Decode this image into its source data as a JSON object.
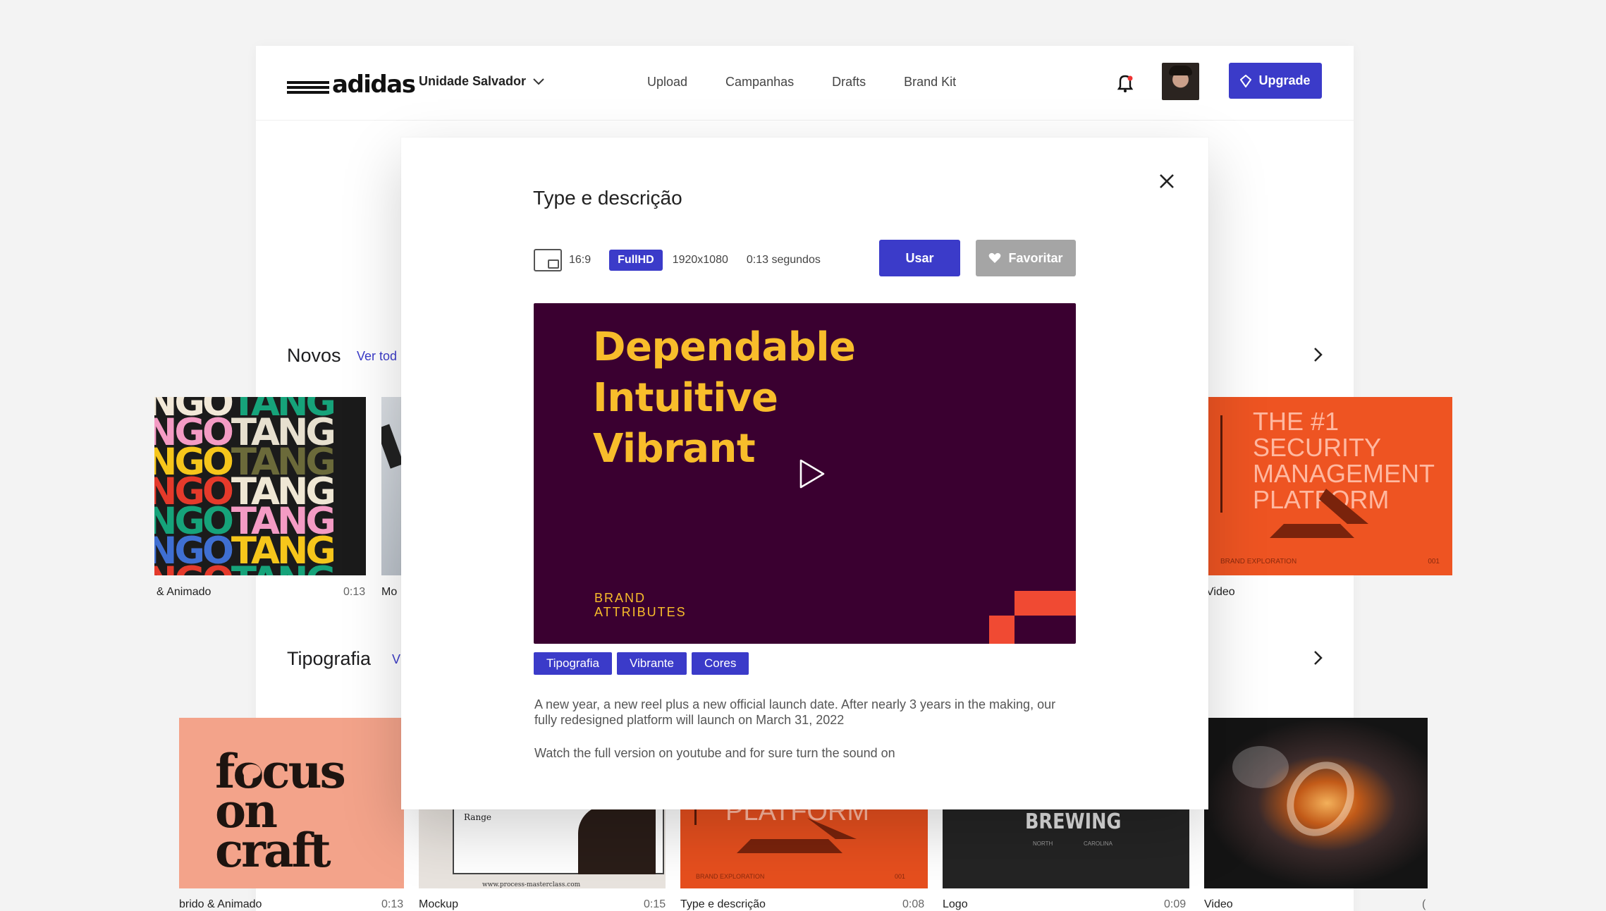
{
  "header": {
    "logo_text": "adidas",
    "unit_label": "Unidade Salvador",
    "nav": [
      "Upload",
      "Campanhas",
      "Drafts",
      "Brand Kit"
    ],
    "upgrade_label": "Upgrade"
  },
  "sections": {
    "novos": {
      "title": "Novos",
      "link": "Ver tod"
    },
    "tipografia": {
      "title": "Tipografia",
      "link": "V"
    }
  },
  "novos_cards": [
    {
      "caption": "& Animado",
      "duration": "0:13",
      "art": "NGO TANG"
    },
    {
      "caption": "Mo",
      "duration": ""
    },
    {
      "caption": "Video",
      "duration": "",
      "art_lines": [
        "THE #1",
        "SECURITY",
        "MANAGEMENT",
        "PLATFORM"
      ],
      "art_small_left": "BRAND EXPLORATION",
      "art_small_right": "001"
    }
  ],
  "tipografia_cards": [
    {
      "caption": "brido & Animado",
      "duration": "0:13",
      "art_lines": [
        "focus",
        "on",
        "craft"
      ]
    },
    {
      "caption": "Mockup",
      "duration": "0:15",
      "art_label": "Range",
      "art_url": "www.process-masterclass.com"
    },
    {
      "caption": "Type e descrição",
      "duration": "0:08",
      "art_text": "PLATFORM",
      "art_small_left": "BRAND EXPLORATION",
      "art_small_right": "001"
    },
    {
      "caption": "Logo",
      "duration": "0:09",
      "art_text": "BREWING",
      "art_small_left": "NORTH",
      "art_small_right": "CAROLINA"
    },
    {
      "caption": "Video",
      "duration": "("
    }
  ],
  "modal": {
    "title": "Type e descrição",
    "ratio": "16:9",
    "quality": "FullHD",
    "resolution": "1920x1080",
    "duration": "0:13 segundos",
    "use_label": "Usar",
    "favorite_label": "Favoritar",
    "video": {
      "lines": [
        "Dependable",
        "Intuitive",
        "Vibrant"
      ],
      "brand_line1": "BRAND",
      "brand_line2": "ATTRIBUTES"
    },
    "tags": [
      "Tipografia",
      "Vibrante",
      "Cores"
    ],
    "description": "A new year, a new reel plus a new official launch date. After nearly 3 years in the making, our fully redesigned platform will launch on March 31, 2022",
    "description2": "Watch the full version on youtube and for sure turn the sound on"
  },
  "colors": {
    "accent": "#3b3bc9",
    "video_bg": "#3a0030",
    "video_text": "#f8bd2b",
    "video_shape": "#f04a33",
    "favorite_bg": "#a5a5a5"
  }
}
